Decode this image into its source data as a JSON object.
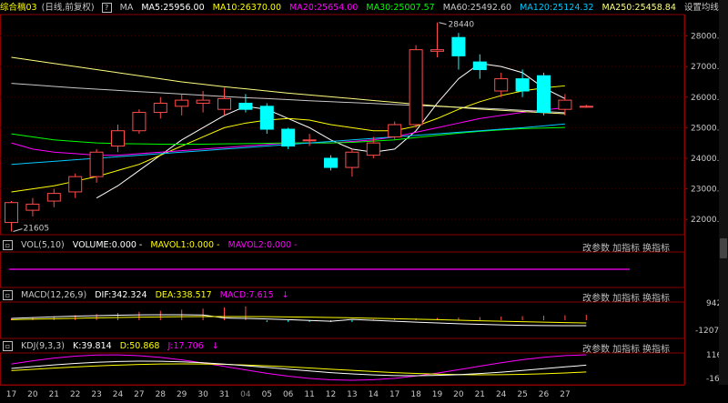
{
  "price_header": {
    "title": "综合稿03",
    "period": "(日线,前复权)",
    "help": "?",
    "indicator": "MA",
    "ma5": "MA5:25956.00",
    "ma10": "MA10:26370.00",
    "ma20": "MA20:25654.00",
    "ma30": "MA30:25007.57",
    "ma60": "MA60:25492.60",
    "ma120": "MA120:25124.32",
    "ma250": "MA250:25458.84",
    "settings": "设置均线"
  },
  "colors": {
    "up": "#ff4b4b",
    "down": "#00ffff",
    "ma5": "#ffffff",
    "ma10": "#ffff00",
    "ma20": "#ff00ff",
    "ma30": "#00ff00",
    "ma60": "#c8c8c8",
    "ma120": "#00c8ff",
    "ma250": "#ffff80"
  },
  "price_axis": [
    "28000.00",
    "27000.00",
    "26000.00",
    "25000.00",
    "24000.00",
    "23000.00",
    "22000.00"
  ],
  "annotations": {
    "high": "28440",
    "low": "21605"
  },
  "chart_data": {
    "type": "candlestick",
    "dates": [
      "17",
      "20",
      "21",
      "22",
      "23",
      "24",
      "27",
      "28",
      "29",
      "30",
      "31",
      "04",
      "05",
      "06",
      "11",
      "12",
      "13",
      "14",
      "17",
      "18",
      "19",
      "20",
      "21",
      "24",
      "25",
      "26",
      "27"
    ],
    "ylim": [
      21500,
      28700
    ],
    "candles": [
      {
        "o": 21900,
        "c": 22550,
        "h": 22600,
        "l": 21605
      },
      {
        "o": 22300,
        "c": 22500,
        "h": 22700,
        "l": 22100
      },
      {
        "o": 22600,
        "c": 22850,
        "h": 23000,
        "l": 22400
      },
      {
        "o": 22900,
        "c": 23400,
        "h": 23500,
        "l": 22700
      },
      {
        "o": 23400,
        "c": 24200,
        "h": 24300,
        "l": 23200
      },
      {
        "o": 24400,
        "c": 24900,
        "h": 25100,
        "l": 24200
      },
      {
        "o": 24900,
        "c": 25500,
        "h": 25600,
        "l": 24800
      },
      {
        "o": 25500,
        "c": 25800,
        "h": 26000,
        "l": 25300
      },
      {
        "o": 25700,
        "c": 25900,
        "h": 26100,
        "l": 25400
      },
      {
        "o": 25800,
        "c": 25900,
        "h": 26200,
        "l": 25500
      },
      {
        "o": 25600,
        "c": 25950,
        "h": 26300,
        "l": 25400
      },
      {
        "o": 25800,
        "c": 25600,
        "h": 26100,
        "l": 25500
      },
      {
        "o": 25700,
        "c": 24950,
        "h": 25800,
        "l": 24800
      },
      {
        "o": 24950,
        "c": 24400,
        "h": 25000,
        "l": 24300
      },
      {
        "o": 24600,
        "c": 24600,
        "h": 24800,
        "l": 24400
      },
      {
        "o": 24000,
        "c": 23700,
        "h": 24100,
        "l": 23600
      },
      {
        "o": 23700,
        "c": 24200,
        "h": 24300,
        "l": 23400
      },
      {
        "o": 24100,
        "c": 24500,
        "h": 24700,
        "l": 24000
      },
      {
        "o": 24700,
        "c": 25100,
        "h": 25200,
        "l": 24600
      },
      {
        "o": 25100,
        "c": 27550,
        "h": 27700,
        "l": 25000
      },
      {
        "o": 27500,
        "c": 27550,
        "h": 28440,
        "l": 27300
      },
      {
        "o": 27950,
        "c": 27350,
        "h": 28100,
        "l": 26900
      },
      {
        "o": 27150,
        "c": 26900,
        "h": 27400,
        "l": 26600
      },
      {
        "o": 26200,
        "c": 26600,
        "h": 26800,
        "l": 26000
      },
      {
        "o": 26600,
        "c": 26200,
        "h": 26900,
        "l": 26000
      },
      {
        "o": 26700,
        "c": 25500,
        "h": 26800,
        "l": 25400
      },
      {
        "o": 25600,
        "c": 25900,
        "h": 26100,
        "l": 25400
      },
      {
        "o": 25700,
        "c": 25700,
        "h": 25750,
        "l": 25650
      }
    ],
    "ma": {
      "ma5": [
        null,
        null,
        null,
        null,
        22700,
        23100,
        23600,
        24100,
        24600,
        25000,
        25400,
        25700,
        25600,
        25300,
        25000,
        24600,
        24300,
        24200,
        24300,
        24900,
        25800,
        26600,
        27100,
        27000,
        26800,
        26300,
        25950
      ],
      "ma10": [
        22900,
        23000,
        23100,
        23250,
        23400,
        23600,
        23800,
        24100,
        24400,
        24700,
        25000,
        25150,
        25250,
        25300,
        25250,
        25100,
        25000,
        24900,
        24900,
        25050,
        25300,
        25600,
        25850,
        26050,
        26200,
        26300,
        26370
      ],
      "ma20": [
        24500,
        24300,
        24200,
        24150,
        24100,
        24100,
        24150,
        24200,
        24250,
        24300,
        24350,
        24400,
        24450,
        24500,
        24500,
        24500,
        24550,
        24600,
        24700,
        24850,
        25000,
        25150,
        25300,
        25400,
        25500,
        25580,
        25654
      ],
      "ma30": [
        24800,
        24700,
        24600,
        24550,
        24500,
        24480,
        24470,
        24460,
        24460,
        24460,
        24470,
        24480,
        24490,
        24500,
        24500,
        24500,
        24520,
        24560,
        24600,
        24680,
        24750,
        24820,
        24880,
        24930,
        24970,
        24990,
        25007
      ],
      "ma60": [
        26450,
        26400,
        26350,
        26300,
        26260,
        26220,
        26180,
        26140,
        26100,
        26060,
        26020,
        25980,
        25950,
        25920,
        25880,
        25850,
        25820,
        25790,
        25760,
        25730,
        25700,
        25670,
        25640,
        25610,
        25570,
        25530,
        25492
      ],
      "ma120": [
        23800,
        23850,
        23900,
        23950,
        24000,
        24050,
        24100,
        24150,
        24200,
        24250,
        24300,
        24350,
        24400,
        24450,
        24500,
        24550,
        24600,
        24650,
        24700,
        24750,
        24800,
        24850,
        24900,
        24950,
        25000,
        25060,
        25124
      ],
      "ma250": [
        27300,
        27200,
        27100,
        27000,
        26900,
        26800,
        26700,
        26600,
        26500,
        26420,
        26340,
        26270,
        26200,
        26130,
        26070,
        26010,
        25950,
        25890,
        25830,
        25770,
        25710,
        25660,
        25610,
        25570,
        25530,
        25490,
        25458
      ]
    }
  },
  "vol_header": {
    "title": "VOL(5,10)",
    "volume": "VOLUME:0.000 -",
    "mavol1": "MAVOL1:0.000 -",
    "mavol2": "MAVOL2:0.000 -",
    "btn_params": "改参数",
    "btn_add": "加指标",
    "btn_switch": "换指标"
  },
  "macd_header": {
    "title": "MACD(12,26,9)",
    "dif": "DIF:342.324",
    "dea": "DEA:338.517",
    "macd": "MACD:7.615",
    "btn_params": "改参数",
    "btn_add": "加指标",
    "btn_switch": "换指标",
    "axis_top": "942",
    "axis_bottom": "-1207"
  },
  "kdj_header": {
    "title": "KDJ(9,3,3)",
    "k": "K:39.814",
    "d": "D:50.868",
    "j": "J:17.706",
    "btn_params": "改参数",
    "btn_add": "加指标",
    "btn_switch": "换指标",
    "axis_top": "116",
    "axis_bottom": "-16"
  },
  "x_axis": [
    "17",
    "20",
    "21",
    "22",
    "23",
    "24",
    "27",
    "28",
    "29",
    "30",
    "31",
    "04",
    "05",
    "06",
    "11",
    "12",
    "13",
    "14",
    "17",
    "18",
    "19",
    "20",
    "21",
    "24",
    "25",
    "26",
    "27"
  ]
}
